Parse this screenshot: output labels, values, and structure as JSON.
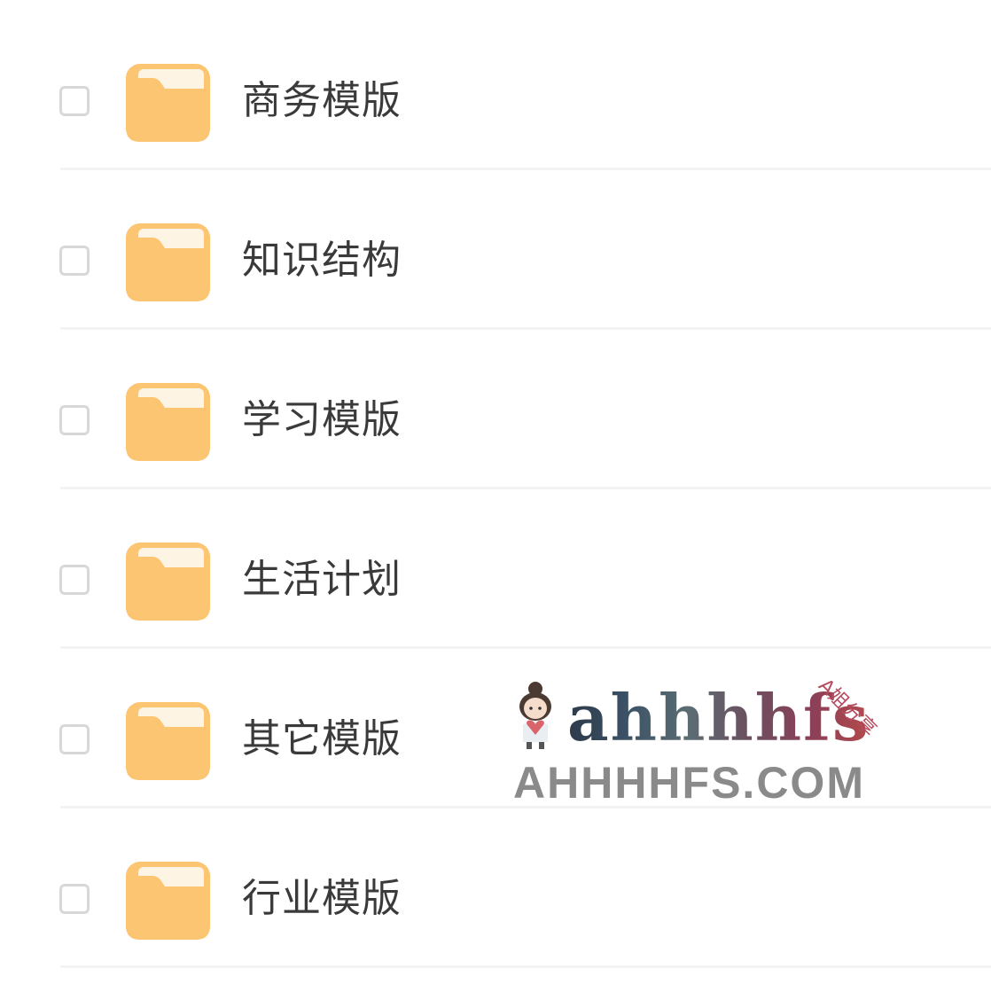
{
  "folders": [
    {
      "name": "商务模版"
    },
    {
      "name": "知识结构"
    },
    {
      "name": "学习模版"
    },
    {
      "name": "生活计划"
    },
    {
      "name": "其它模版"
    },
    {
      "name": "行业模版"
    }
  ],
  "watermark": {
    "logo_text": "ahhhhfs",
    "site_text": "AHHHHFS.COM",
    "tag_text": "A姐分享"
  },
  "colors": {
    "folder": "#fcc571",
    "folder_tab": "#fbe3b6",
    "checkbox_border": "#d8d8d8",
    "label_text": "#3a3a3a",
    "divider": "#f3f3f3"
  },
  "icons": {
    "folder": "folder-icon",
    "checkbox": "checkbox-icon"
  }
}
